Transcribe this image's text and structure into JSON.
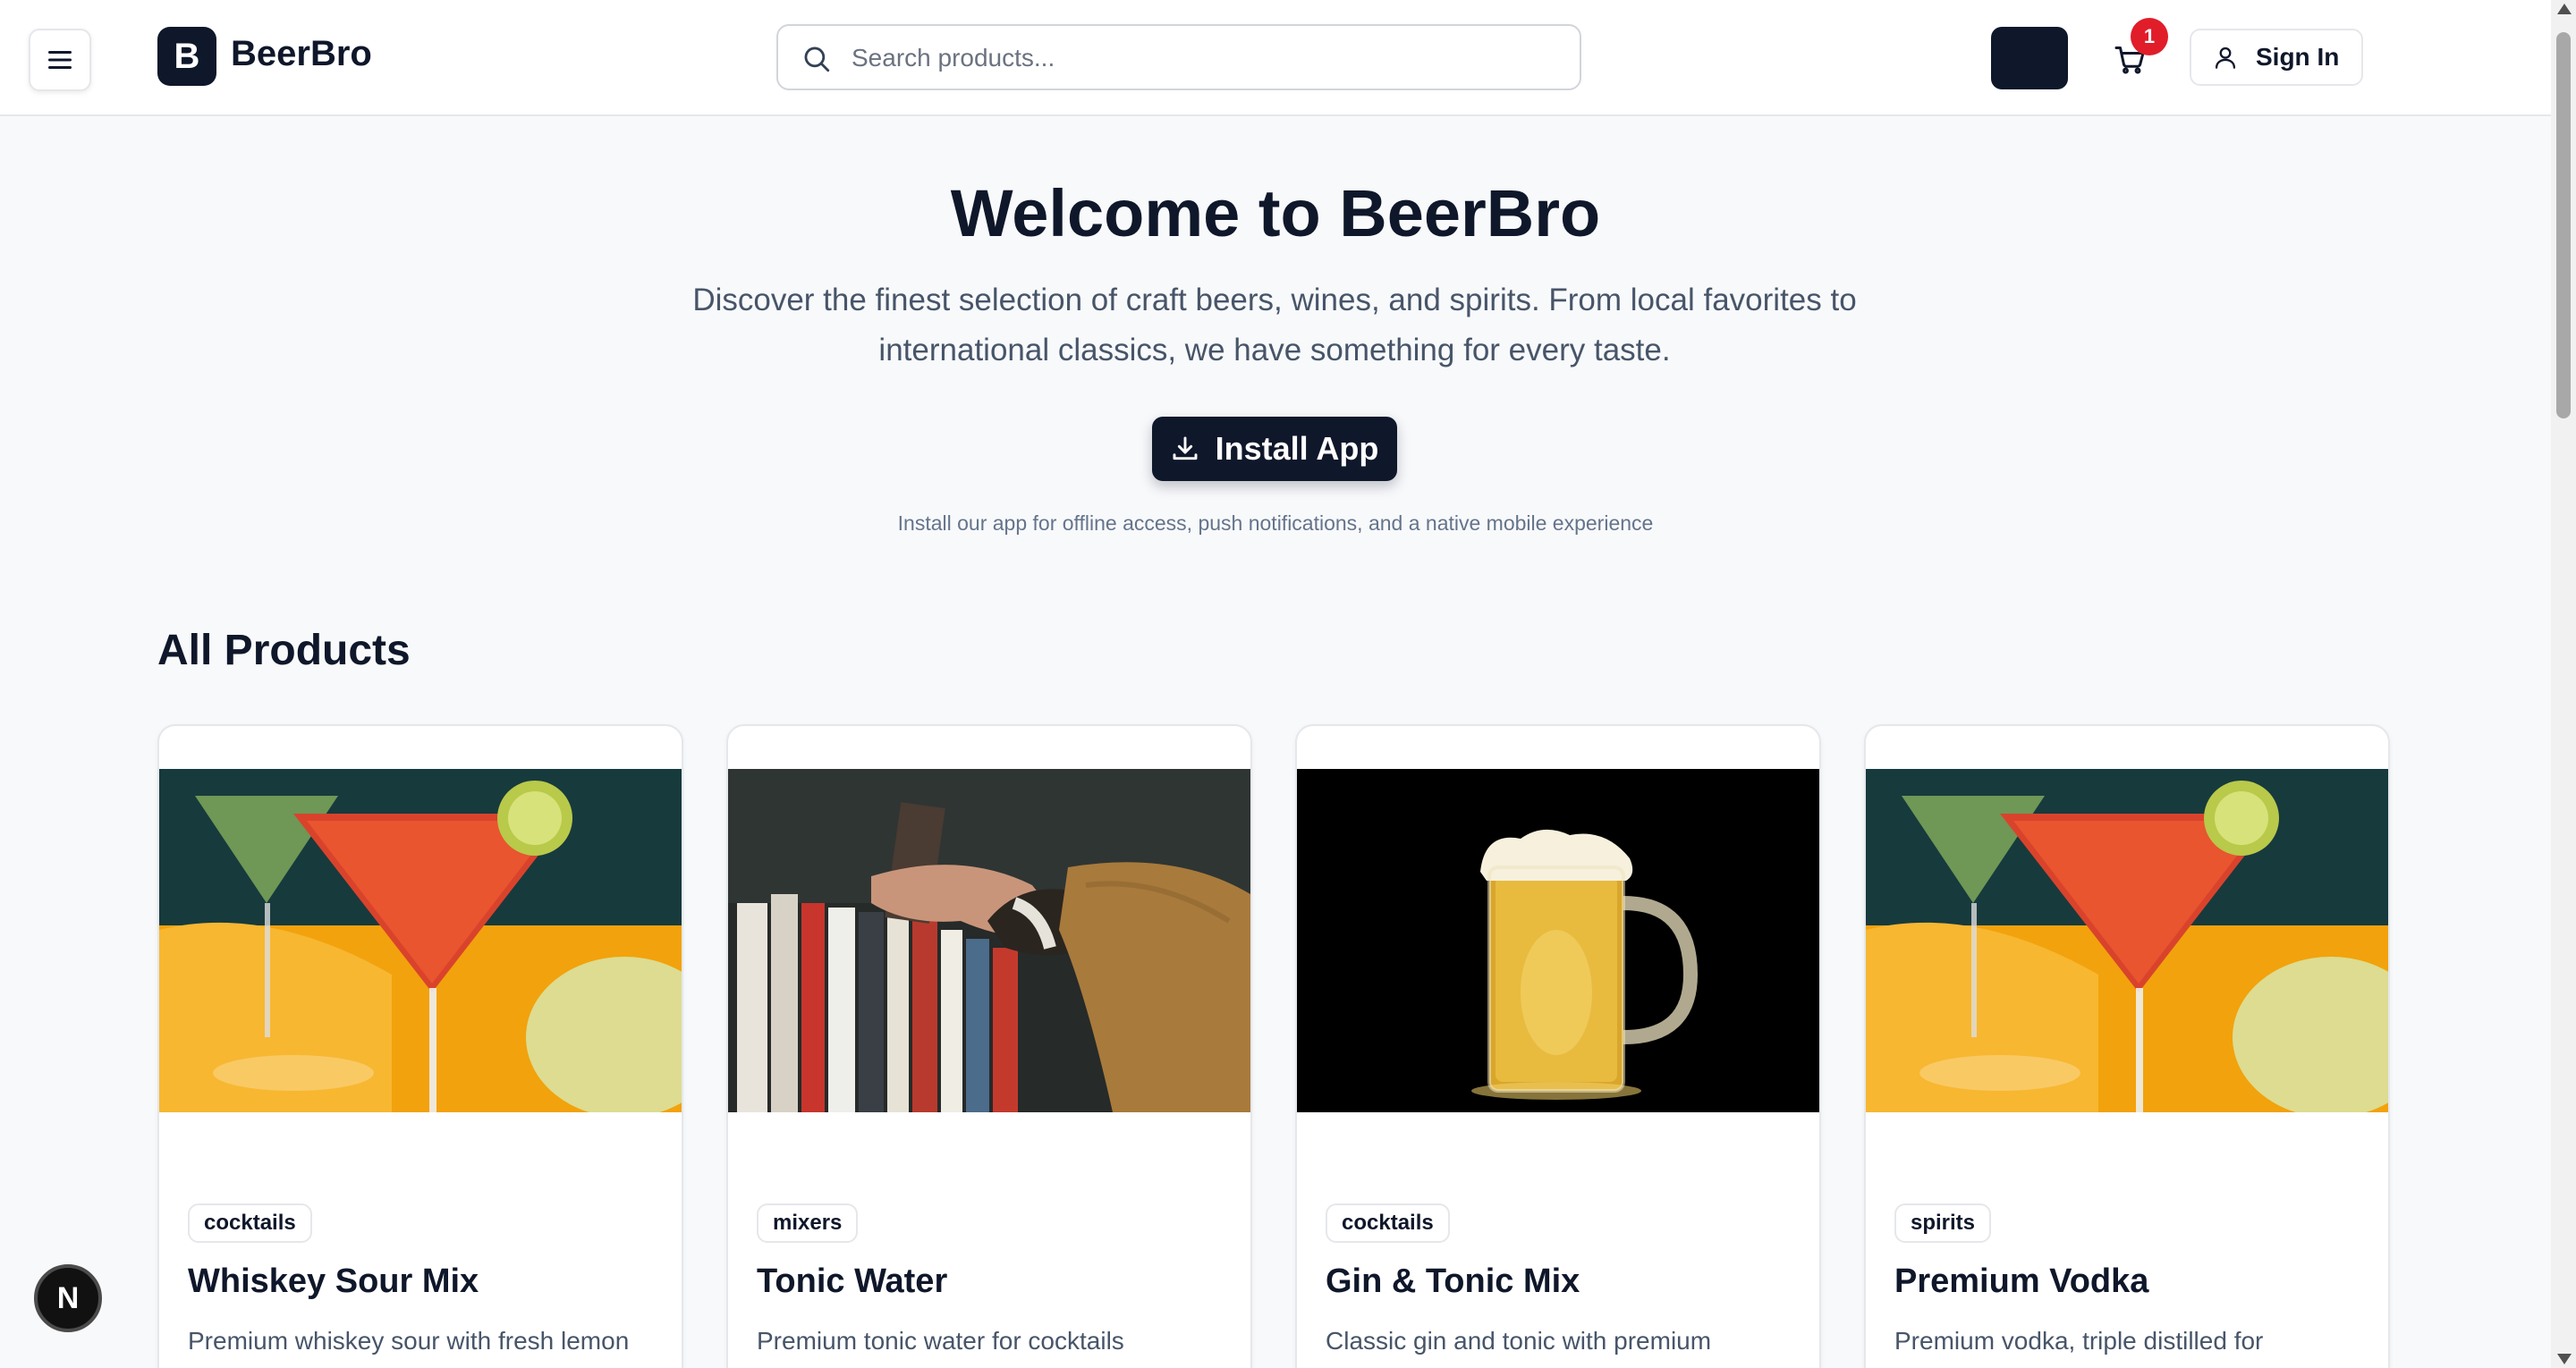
{
  "header": {
    "brand_letter": "B",
    "brand_name": "BeerBro",
    "search_placeholder": "Search products...",
    "cart_count": "1",
    "signin_label": "Sign In"
  },
  "hero": {
    "title": "Welcome to BeerBro",
    "description": "Discover the finest selection of craft beers, wines, and spirits. From local favorites to international classics, we have something for every taste.",
    "install_label": "Install App",
    "install_note": "Install our app for offline access, push notifications, and a native mobile experience"
  },
  "products": {
    "section_title": "All Products",
    "items": [
      {
        "category": "cocktails",
        "name": "Whiskey Sour Mix",
        "description": "Premium whiskey sour with fresh lemon",
        "image": "cocktail-glasses-photo"
      },
      {
        "category": "mixers",
        "name": "Tonic Water",
        "description": "Premium tonic water for cocktails",
        "image": "bookshelf-hand-photo"
      },
      {
        "category": "cocktails",
        "name": "Gin & Tonic Mix",
        "description": "Classic gin and tonic with premium",
        "image": "beer-mug-photo"
      },
      {
        "category": "spirits",
        "name": "Premium Vodka",
        "description": "Premium vodka, triple distilled for",
        "image": "cocktail-glasses-photo"
      }
    ]
  },
  "floating_badge": {
    "letter": "N"
  },
  "colors": {
    "primary": "#0f172a",
    "badge_red": "#e11d2a",
    "background": "#f8f9fb"
  }
}
